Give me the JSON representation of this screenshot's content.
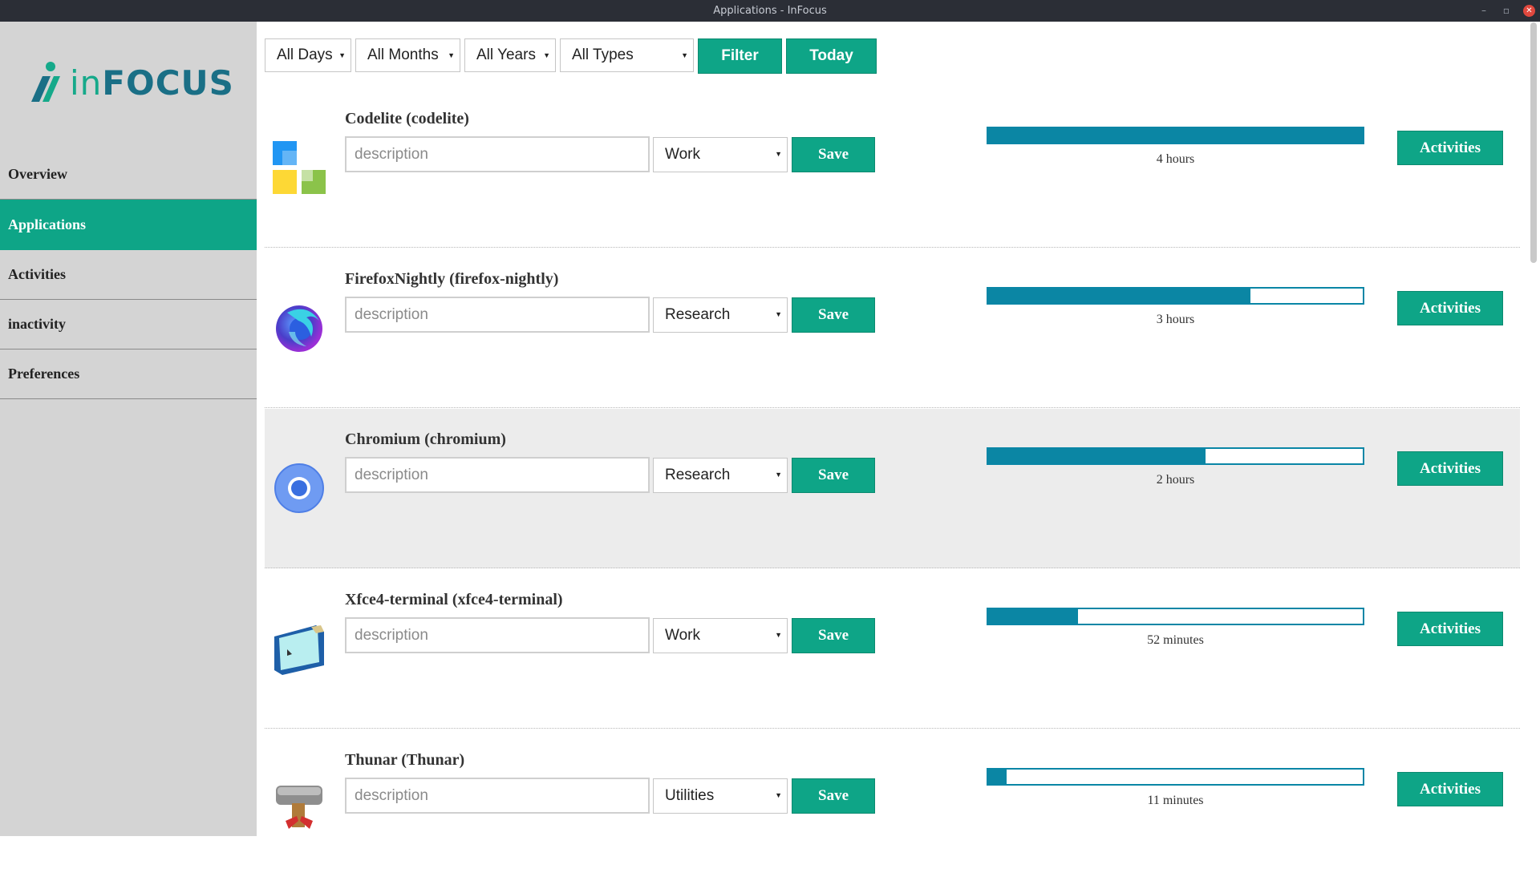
{
  "window": {
    "title": "Applications - InFocus",
    "minimize": "–",
    "maximize": "▫",
    "close": "✕"
  },
  "logo": {
    "text_main": "in",
    "text_rest": "FOCUS"
  },
  "sidebar": {
    "items": [
      {
        "label": "Overview",
        "active": false
      },
      {
        "label": "Applications",
        "active": true
      },
      {
        "label": "Activities",
        "active": false
      },
      {
        "label": "inactivity",
        "active": false
      },
      {
        "label": "Preferences",
        "active": false
      }
    ]
  },
  "filters": {
    "days": "All Days",
    "months": "All Months",
    "years": "All Years",
    "types": "All Types",
    "filter_label": "Filter",
    "today_label": "Today"
  },
  "apps": [
    {
      "name": "Codelite (codelite)",
      "placeholder": "description",
      "type": "Work",
      "save": "Save",
      "usage_fraction": 1.0,
      "duration": "4 hours",
      "activities": "Activities",
      "icon": "codelite-icon"
    },
    {
      "name": "FirefoxNightly (firefox-nightly)",
      "placeholder": "description",
      "type": "Research",
      "save": "Save",
      "usage_fraction": 0.7,
      "duration": "3 hours",
      "activities": "Activities",
      "icon": "firefox-icon"
    },
    {
      "name": "Chromium (chromium)",
      "placeholder": "description",
      "type": "Research",
      "save": "Save",
      "usage_fraction": 0.58,
      "duration": "2 hours",
      "activities": "Activities",
      "icon": "chromium-icon"
    },
    {
      "name": "Xfce4-terminal (xfce4-terminal)",
      "placeholder": "description",
      "type": "Work",
      "save": "Save",
      "usage_fraction": 0.24,
      "duration": "52 minutes",
      "activities": "Activities",
      "icon": "terminal-icon"
    },
    {
      "name": "Thunar (Thunar)",
      "placeholder": "description",
      "type": "Utilities",
      "save": "Save",
      "usage_fraction": 0.05,
      "duration": "11 minutes",
      "activities": "Activities",
      "icon": "thunar-icon"
    }
  ],
  "colors": {
    "accent": "#0ea587",
    "bar": "#0b86a4",
    "sidebar": "#d4d4d4"
  }
}
